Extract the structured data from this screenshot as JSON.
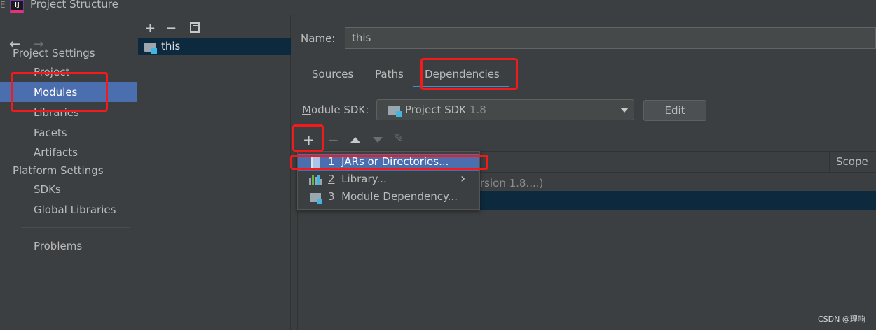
{
  "window": {
    "title": "Project Structure",
    "edge_char": "E"
  },
  "nav": {
    "back_glyph": "←",
    "forward_glyph": "→",
    "project_settings_header": "Project Settings",
    "project_settings_items": [
      "Project",
      "Modules",
      "Libraries",
      "Facets",
      "Artifacts"
    ],
    "selected_item": "Modules",
    "platform_settings_header": "Platform Settings",
    "platform_settings_items": [
      "SDKs",
      "Global Libraries"
    ],
    "problems": "Problems"
  },
  "modules": {
    "toolbar": {
      "add": "+",
      "remove": "−"
    },
    "items": [
      "this"
    ]
  },
  "module": {
    "name_label_pre": "N",
    "name_label_mn": "a",
    "name_label_post": "me:",
    "name_value": "this",
    "tabs": [
      "Sources",
      "Paths",
      "Dependencies"
    ],
    "active_tab": "Dependencies",
    "sdk_label_mn": "M",
    "sdk_label_post": "odule SDK:",
    "sdk_value": "Project SDK",
    "sdk_version": "1.8",
    "edit_mn": "E",
    "edit_post": "dit"
  },
  "dependencies": {
    "toolbar": {
      "add": "+",
      "remove": "−",
      "edit": "✎"
    },
    "scope_header": "Scope",
    "row1_text": "rsion 1.8....)"
  },
  "popup": {
    "items": [
      {
        "num": "1",
        "label": "JARs or Directories...",
        "icon": "jar-icon"
      },
      {
        "num": "2",
        "label": "Library...",
        "icon": "library-icon",
        "submenu": "›"
      },
      {
        "num": "3",
        "label": "Module Dependency...",
        "icon": "module-icon"
      }
    ]
  },
  "colors": {
    "background": "#3c3f41",
    "selection": "#4b6eaf",
    "tab_underline": "#4a88c7",
    "annotation": "#f21a1a"
  },
  "watermark": "CSDN @理响"
}
